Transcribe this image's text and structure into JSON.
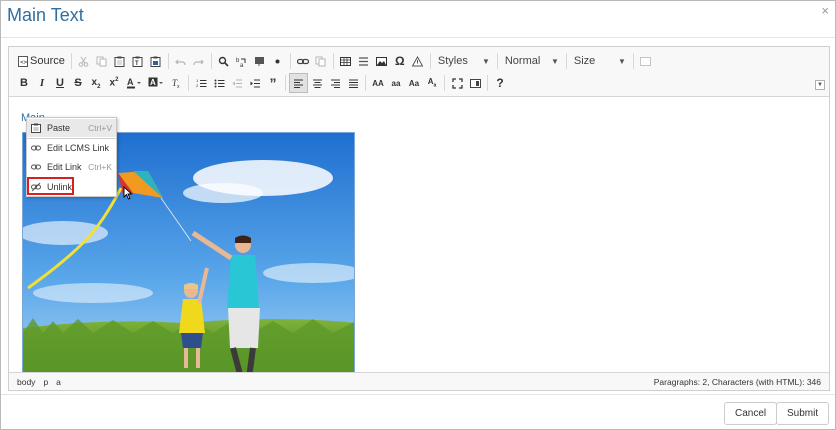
{
  "dialog": {
    "title": "Main Text",
    "close_glyph": "×"
  },
  "toolbar": {
    "source_label": "Source",
    "styles_combo": "Styles",
    "format_combo": "Normal",
    "size_combo": "Size"
  },
  "content": {
    "link_text": "Main"
  },
  "context_menu": {
    "items": [
      {
        "label": "Paste",
        "shortcut": "Ctrl+V"
      },
      {
        "label": "Edit LCMS Link",
        "shortcut": ""
      },
      {
        "label": "Edit Link",
        "shortcut": "Ctrl+K"
      },
      {
        "label": "Unlink",
        "shortcut": ""
      }
    ]
  },
  "statusbar": {
    "path": [
      "body",
      "p",
      "a"
    ],
    "stats": "Paragraphs: 2, Characters (with HTML): 346"
  },
  "buttons": {
    "cancel": "Cancel",
    "submit": "Submit"
  },
  "colors": {
    "title": "#2f6f9f",
    "highlight": "#d92020",
    "selection_border": "#7aa7d8"
  }
}
